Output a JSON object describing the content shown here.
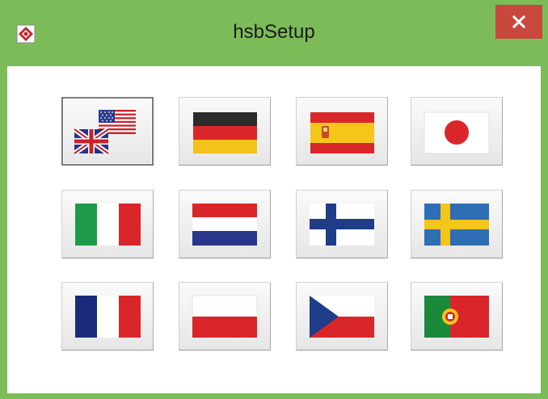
{
  "window": {
    "title": "hsbSetup",
    "app_icon": "hsb-logo-icon",
    "close_icon": "close-icon",
    "accent_color": "#7cbc58",
    "close_color": "#c8483d"
  },
  "flags": [
    {
      "name": "flag-english",
      "icon": "uk-us-flag-icon",
      "selected": true
    },
    {
      "name": "flag-german",
      "icon": "germany-flag-icon",
      "selected": false
    },
    {
      "name": "flag-spanish",
      "icon": "spain-flag-icon",
      "selected": false
    },
    {
      "name": "flag-japanese",
      "icon": "japan-flag-icon",
      "selected": false
    },
    {
      "name": "flag-italian",
      "icon": "italy-flag-icon",
      "selected": false
    },
    {
      "name": "flag-dutch",
      "icon": "netherlands-flag-icon",
      "selected": false
    },
    {
      "name": "flag-finnish",
      "icon": "finland-flag-icon",
      "selected": false
    },
    {
      "name": "flag-swedish",
      "icon": "sweden-flag-icon",
      "selected": false
    },
    {
      "name": "flag-french",
      "icon": "france-flag-icon",
      "selected": false
    },
    {
      "name": "flag-polish",
      "icon": "poland-flag-icon",
      "selected": false
    },
    {
      "name": "flag-czech",
      "icon": "czech-flag-icon",
      "selected": false
    },
    {
      "name": "flag-portuguese",
      "icon": "portugal-flag-icon",
      "selected": false
    }
  ]
}
